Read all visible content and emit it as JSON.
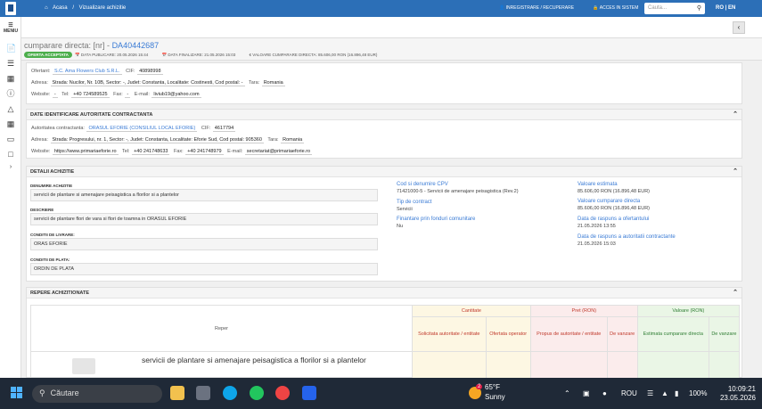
{
  "topbar": {
    "breadcrumb_home": "Acasa",
    "breadcrumb_sep": "/",
    "breadcrumb_current": "Vizualizare achizitie",
    "link_register": "INREGISTRARE / RECUPERARE",
    "link_login": "ACCES IN SISTEM",
    "search_placeholder": "Cauta...",
    "lang": "RO | EN"
  },
  "sidebar": {
    "menu_label": "MENIU"
  },
  "header": {
    "title_prefix": "cumparare directa: [nr] -",
    "title_code": "DA40442687",
    "status_badge": "OFERTA ACCEPTATA",
    "data_publicare": "DATA PUBLICARE: 20.05.2026 15:44",
    "data_finalizare": "DATA FINALIZARE: 21.05.2026 15:03",
    "valoare": "VALOARE CUMPARARE DIRECTA: 85.606,00 RON (16.896,48 EUR)"
  },
  "ofertant": {
    "label": "Ofertant:",
    "name": "S.C. Ama Flowers Club S.R.L.",
    "cif_label": "CIF:",
    "cif": "40898998",
    "adresa_label": "Adresa:",
    "adresa": "Strada: Nucilor, Nr. 10B, Sector: -, Judet: Constanta, Localitate: Costinesti, Cod postal: -",
    "tara_label": "Tara:",
    "tara": "Romania",
    "website_label": "Website:",
    "website": "-",
    "tel_label": "Tel:",
    "tel": "+40 724589525",
    "fax_label": "Fax:",
    "fax": "-",
    "email_label": "E-mail:",
    "email": "liviub19@yahoo.com"
  },
  "autoritate": {
    "section_title": "DATE IDENTIFICARE AUTORITATE CONTRACTANTA",
    "label": "Autoritatea contractanta:",
    "name": "ORASUL EFORIE (CONSILIUL LOCAL EFORIE)",
    "cif_label": "CIF:",
    "cif": "4617794",
    "adresa_label": "Adresa:",
    "adresa": "Strada: Progresului, nr. 1, Sector: -, Judet: Constanta, Localitate: Eforie Sud, Cod postal: 905360",
    "tara_label": "Tara:",
    "tara": "Romania",
    "website_label": "Website:",
    "website": "https://www.primariaeforie.ro",
    "tel_label": "Tel:",
    "tel": "+40 241748633",
    "fax_label": "Fax:",
    "fax": "+40 241748979",
    "email_label": "E-mail:",
    "email": "secretariat@primariaeforie.ro"
  },
  "detalii": {
    "section_title": "DETALII ACHIZITIE",
    "denumire_label": "DENUMIRE ACHIZITIE",
    "denumire": "servicii de plantare si amenajare peisagistica a florilor si a plantelor",
    "descriere_label": "DESCRIERE",
    "descriere": "servicii de plantare flori de vara si flori de toamna in ORASUL EFORIE",
    "livrare_label": "CONDITII DE LIVRARE:",
    "livrare": "ORAS EFORIE",
    "plata_label": "CONDITII DE PLATA:",
    "plata": "ORDIN DE PLATA",
    "cpv_label": "Cod si denumire CPV",
    "cpv": "71421000-5 - Servicii de amenajare peisagistica (Rev.2)",
    "tip_label": "Tip de contract",
    "tip": "Servicii",
    "fonduri_label": "Finantare prin fonduri comunitare",
    "fonduri": "Nu",
    "val_estimata_label": "Valoare estimata",
    "val_estimata": "85.606,00  RON (16.896,48  EUR)",
    "val_cumparare_label": "Valoare cumparare directa",
    "val_cumparare": "85.606,00  RON (16.896,48  EUR)",
    "raspuns_ofertant_label": "Data de raspuns a ofertantului",
    "raspuns_ofertant": "21.05.2026 13:55",
    "raspuns_autoritate_label": "Data de raspuns a autoritatii contractante",
    "raspuns_autoritate": "21.05.2026 15:03"
  },
  "repere": {
    "section_title": "REPERE ACHIZITIONATE",
    "col_reper": "Reper",
    "grp_cantitate": "Cantitate",
    "grp_pret": "Pret (RON)",
    "grp_valoare": "Valoare (RON)",
    "sub_solicitata": "Solicitata autoritate / entitate",
    "sub_ofertata": "Ofertata operator",
    "sub_propus": "Propus de autoritate / entitate",
    "sub_vanzare_pret": "De vanzare",
    "sub_estimata": "Estimata cumparare directa",
    "sub_vanzare_val": "De vanzare",
    "item_name": "servicii de plantare si amenajare peisagistica a florilor si a plantelor"
  },
  "taskbar": {
    "search": "Căutare",
    "temp": "65°F",
    "weather": "Sunny",
    "weather_badge": "2",
    "lang": "ROU",
    "battery": "100%",
    "time": "10:09:21",
    "date": "23.05.2026"
  }
}
